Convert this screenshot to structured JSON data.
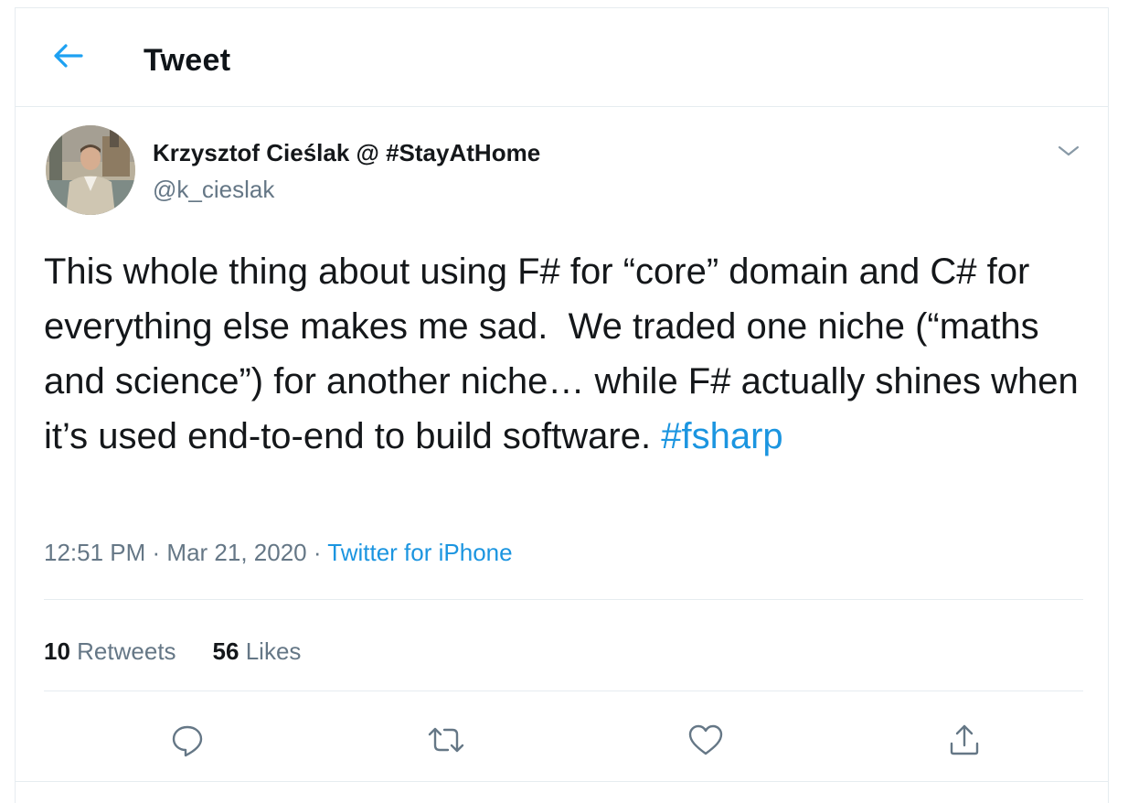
{
  "header": {
    "title": "Tweet",
    "back_icon": "arrow-left-icon"
  },
  "tweet": {
    "author": {
      "display_name": "Krzysztof Cieślak @ #StayAtHome",
      "handle": "@k_cieslak"
    },
    "text": "This whole thing about using F# for “core” domain and C# for everything else makes me sad.  We traded one niche (“maths and science”) for another niche… while F# actually shines when it’s used end-to-end to build software. ",
    "hashtag": "#fsharp",
    "time": "12:51 PM",
    "separator1": " · ",
    "date": "Mar 21, 2020",
    "separator2": " · ",
    "source": "Twitter for iPhone"
  },
  "stats": {
    "retweets_count": "10",
    "retweets_label": "Retweets",
    "likes_count": "56",
    "likes_label": "Likes"
  },
  "actions": [
    {
      "icon": "reply-icon"
    },
    {
      "icon": "retweet-icon"
    },
    {
      "icon": "like-icon"
    },
    {
      "icon": "share-icon"
    }
  ],
  "colors": {
    "accent": "#1da1f2",
    "link": "#1b95e0",
    "secondary_text": "#657786",
    "primary_text": "#14171a",
    "border": "#e6ecf0"
  }
}
